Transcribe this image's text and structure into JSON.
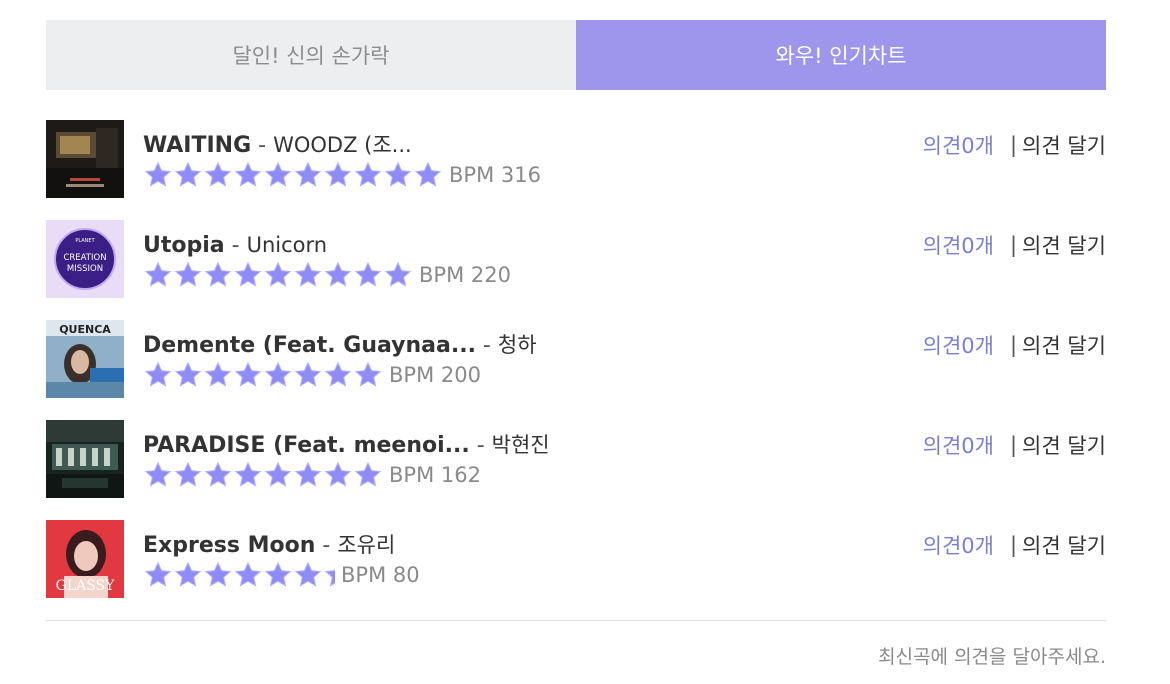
{
  "tabs": [
    {
      "label": "달인! 신의 손가락",
      "active": false
    },
    {
      "label": "와우! 인기차트",
      "active": true
    }
  ],
  "colors": {
    "tab_active_bg": "#9d96ec",
    "tab_inactive_bg": "#edeef0",
    "star": "#8f8cf5",
    "comment_link": "#7b7fd4"
  },
  "songs": [
    {
      "title": "WAITING",
      "separator": " - ",
      "artist": "WOODZ (조...",
      "stars": 10,
      "bpm": "BPM 316",
      "comments": "의견0개",
      "divider": "|",
      "action": "의견 달기",
      "art": "dark-studio-art-icon"
    },
    {
      "title": "Utopia",
      "separator": " - ",
      "artist": "Unicorn",
      "stars": 9,
      "bpm": "BPM 220",
      "comments": "의견0개",
      "divider": "|",
      "action": "의견 달기",
      "art": "creation-mission-art-icon"
    },
    {
      "title": "Demente (Feat. Guaynaa...",
      "separator": " - ",
      "artist": "청하",
      "stars": 8,
      "bpm": "BPM 200",
      "comments": "의견0개",
      "divider": "|",
      "action": "의견 달기",
      "art": "querencia-art-icon"
    },
    {
      "title": "PARADISE (Feat. meenoi...",
      "separator": " - ",
      "artist": "박현진",
      "stars": 8,
      "bpm": "BPM 162",
      "comments": "의견0개",
      "divider": "|",
      "action": "의견 달기",
      "art": "train-station-art-icon"
    },
    {
      "title": "Express Moon",
      "separator": " - ",
      "artist": "조유리",
      "stars": 6.4,
      "bpm": "BPM 80",
      "comments": "의견0개",
      "divider": "|",
      "action": "의견 달기",
      "art": "glassy-art-icon"
    }
  ],
  "footer": {
    "text": "최신곡에 의견을 달아주세요."
  }
}
